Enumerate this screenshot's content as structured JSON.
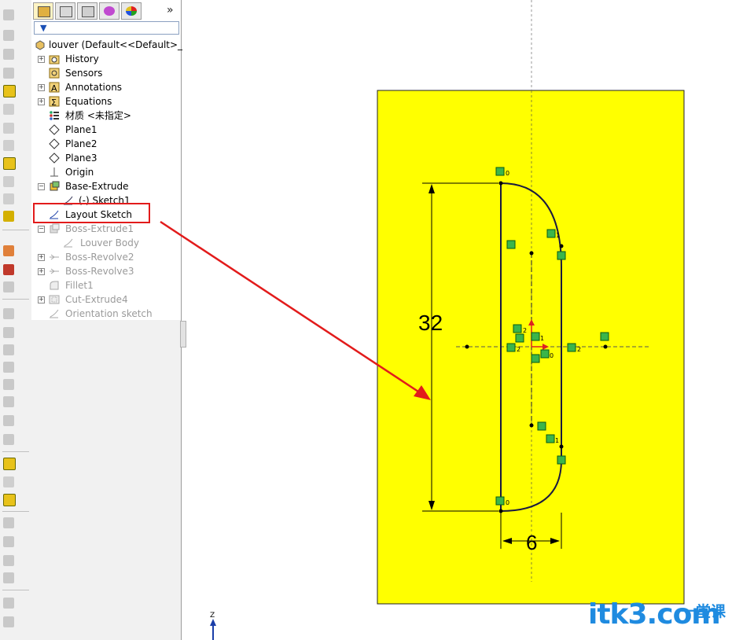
{
  "feature_manager": {
    "tabs": [
      {
        "icon": "feature-manager-tree-icon"
      },
      {
        "icon": "property-manager-icon"
      },
      {
        "icon": "configuration-manager-icon"
      },
      {
        "icon": "dimxpert-manager-icon"
      },
      {
        "icon": "display-manager-icon"
      }
    ],
    "more_label": "»",
    "filter_icon": "filter-icon",
    "root_label": "louver  (Default<<Default>_",
    "items": [
      {
        "label": "History",
        "icon": "history-folder-icon",
        "dim": false
      },
      {
        "label": "Sensors",
        "icon": "sensors-icon",
        "dim": false
      },
      {
        "label": "Annotations",
        "icon": "annotations-icon",
        "dim": false
      },
      {
        "label": "Equations",
        "icon": "equations-icon",
        "dim": false
      },
      {
        "label": "材质 <未指定>",
        "icon": "material-icon",
        "dim": false
      },
      {
        "label": "Plane1",
        "icon": "plane-icon",
        "dim": false
      },
      {
        "label": "Plane2",
        "icon": "plane-icon",
        "dim": false
      },
      {
        "label": "Plane3",
        "icon": "plane-icon",
        "dim": false
      },
      {
        "label": "Origin",
        "icon": "origin-icon",
        "dim": false
      },
      {
        "label": "Base-Extrude",
        "icon": "extrude-icon",
        "dim": false
      },
      {
        "label": "(-) Sketch1",
        "icon": "sketch-icon",
        "dim": false
      },
      {
        "label": "Layout Sketch",
        "icon": "sketch-icon",
        "dim": false
      },
      {
        "label": "Boss-Extrude1",
        "icon": "extrude-icon",
        "dim": true
      },
      {
        "label": "Louver Body",
        "icon": "sketch-icon",
        "dim": true
      },
      {
        "label": "Boss-Revolve2",
        "icon": "revolve-icon",
        "dim": true
      },
      {
        "label": "Boss-Revolve3",
        "icon": "revolve-icon",
        "dim": true
      },
      {
        "label": "Fillet1",
        "icon": "fillet-icon",
        "dim": true
      },
      {
        "label": "Cut-Extrude4",
        "icon": "cut-extrude-icon",
        "dim": true
      },
      {
        "label": "Orientation sketch",
        "icon": "sketch-icon",
        "dim": true
      }
    ]
  },
  "graphics": {
    "dimension_height": "32",
    "dimension_width": "6",
    "relation_labels": [
      "0",
      "1",
      "2",
      "1",
      "2",
      "0",
      "2",
      "1",
      "0"
    ],
    "axis_label": "Z",
    "face_color": "#ffff00"
  },
  "annotation": {
    "highlight_color": "#e21b1b"
  },
  "watermark": {
    "text": "itk3",
    "suffix": ".com",
    "chinese": "一堂课"
  }
}
